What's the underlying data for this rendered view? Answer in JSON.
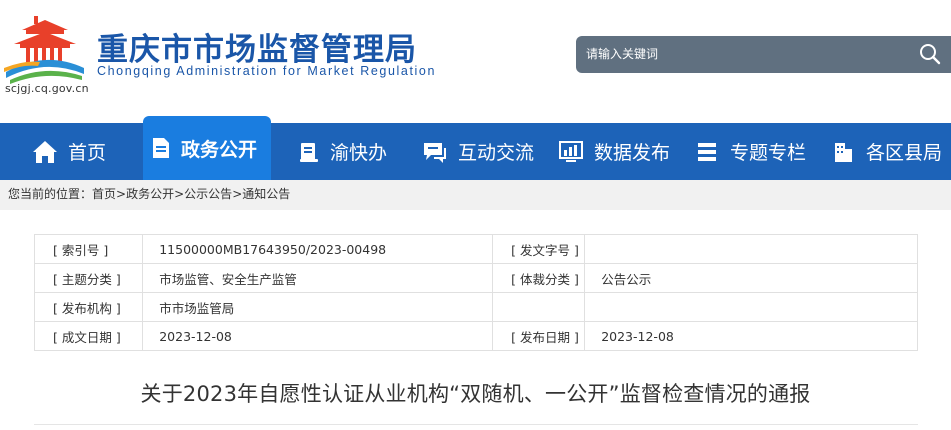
{
  "header": {
    "site_title": "重庆市市场监督管理局",
    "site_subtitle": "Chongqing  Administration for Market Regulation",
    "domain": "scjgj.cq.gov.cn",
    "search_placeholder": "请输入关键词"
  },
  "nav": {
    "items": [
      {
        "label": "首页",
        "icon": "home-icon"
      },
      {
        "label": "政务公开",
        "icon": "document-icon",
        "active": true
      },
      {
        "label": "渝快办",
        "icon": "book-icon"
      },
      {
        "label": "互动交流",
        "icon": "chat-icon"
      },
      {
        "label": "数据发布",
        "icon": "chart-monitor-icon"
      },
      {
        "label": "专题专栏",
        "icon": "layers-icon"
      },
      {
        "label": "各区县局",
        "icon": "building-icon"
      }
    ]
  },
  "breadcrumb": {
    "prefix": "您当前的位置：",
    "items": [
      "首页",
      "政务公开",
      "公示公告",
      "通知公告"
    ],
    "separator": ">"
  },
  "meta": {
    "rows": [
      {
        "l1": "[ 索引号 ]",
        "v1": "11500000MB17643950/2023-00498",
        "l2": "[ 发文字号 ]",
        "v2": ""
      },
      {
        "l1": "[ 主题分类 ]",
        "v1": "市场监管、安全生产监管",
        "l2": "[ 体裁分类 ]",
        "v2": "公告公示"
      },
      {
        "l1": "[ 发布机构 ]",
        "v1": "市市场监管局",
        "l2": "",
        "v2": ""
      },
      {
        "l1": "[ 成文日期 ]",
        "v1": "2023-12-08",
        "l2": "[ 发布日期 ]",
        "v2": "2023-12-08"
      }
    ]
  },
  "article": {
    "title": "关于2023年自愿性认证从业机构“双随机、一公开”监督检查情况的通报"
  },
  "colors": {
    "nav_bg": "#1d63b8",
    "nav_active": "#1a7de0",
    "brand_blue": "#1a56a8",
    "search_bg": "#607080"
  }
}
